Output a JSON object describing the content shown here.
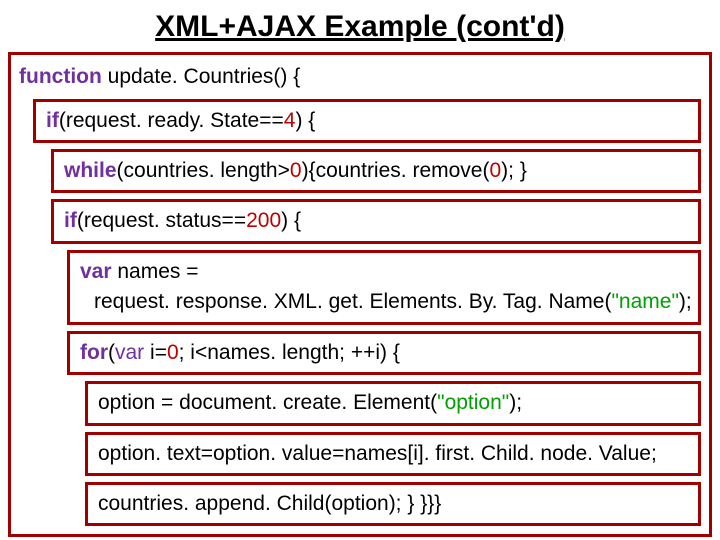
{
  "title": "XML+AJAX Example (cont'd)",
  "code": {
    "l1_kw": "function",
    "l1_rest": " update. Countries() {",
    "l2_kw": "if",
    "l2_mid": "(request. ready. State==",
    "l2_num": "4",
    "l2_end": ") {",
    "l3_kw": "while",
    "l3_mid": "(countries. length>",
    "l3_num": "0",
    "l3_mid2": "){countries. remove(",
    "l3_num2": "0",
    "l3_end": "); }",
    "l4_kw": "if",
    "l4_mid": "(request. status==",
    "l4_num": "200",
    "l4_end": ") {",
    "l5_kw": "var",
    "l5_rest": " names =",
    "l5b": "request. response. XML. get. Elements. By. Tag. Name(",
    "l5b_str": "\"name\"",
    "l5b_end": ");",
    "l6_kw": "for",
    "l6_a": "(",
    "l6_kw2": "var",
    "l6_b": " i=",
    "l6_num1": "0",
    "l6_c": "; i<names. length; ++i) {",
    "l7_a": "option = document. create. Element(",
    "l7_str": "\"option\"",
    "l7_b": ");",
    "l8": "option. text=option. value=names[i]. first. Child. node. Value;",
    "l9": "countries. append. Child(option); } }}}"
  }
}
